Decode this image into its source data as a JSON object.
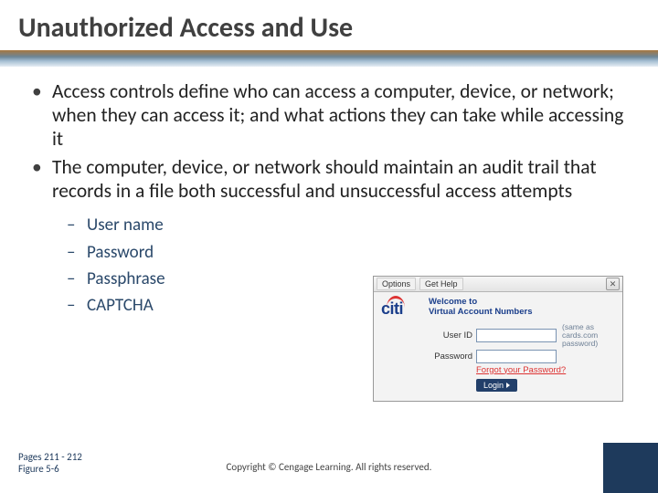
{
  "title": "Unauthorized Access and Use",
  "bullets": [
    "Access controls define who can access a computer, device, or network; when they can access it; and what actions they can take while accessing it",
    "The computer, device, or network should maintain an audit trail  that records in a file both successful and unsuccessful access attempts"
  ],
  "subbullets": [
    "User name",
    "Password",
    "Passphrase",
    "CAPTCHA"
  ],
  "login": {
    "menu_options": "Options",
    "menu_help": "Get Help",
    "logo_text": "citi",
    "welcome_line1": "Welcome to",
    "welcome_line2": "Virtual Account Numbers",
    "user_label": "User ID",
    "pass_label": "Password",
    "note": "(same as cards.com password)",
    "forgot": "Forgot your Password?",
    "login_btn": "Login"
  },
  "footer": {
    "pages": "Pages 211 - 212",
    "figure": "Figure 5-6",
    "copyright": "Copyright © Cengage Learning. All rights reserved."
  }
}
